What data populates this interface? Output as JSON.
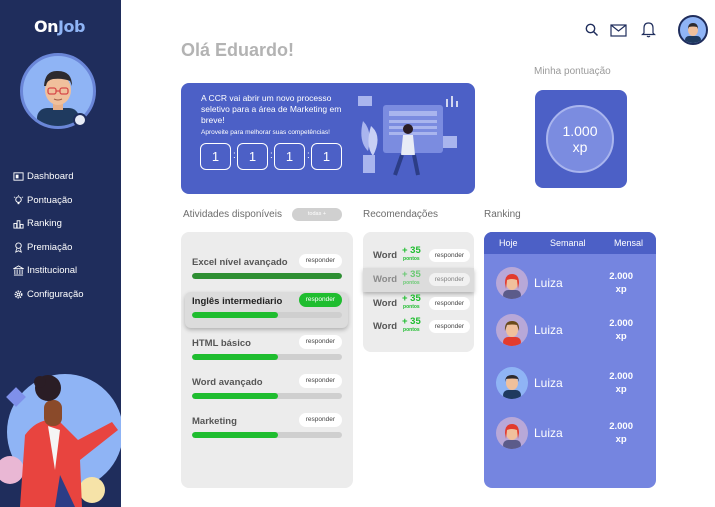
{
  "app": {
    "logo_a": "On",
    "logo_b": "Job"
  },
  "sidebar": {
    "items": [
      {
        "label": "Dashboard",
        "icon": "dashboard-icon"
      },
      {
        "label": "Pontuação",
        "icon": "lightbulb-icon"
      },
      {
        "label": "Ranking",
        "icon": "ranking-icon"
      },
      {
        "label": "Premiação",
        "icon": "award-icon"
      },
      {
        "label": "Institucional",
        "icon": "building-icon"
      },
      {
        "label": "Configuração",
        "icon": "gear-icon"
      }
    ]
  },
  "header": {
    "greeting": "Olá Eduardo!"
  },
  "banner": {
    "text": "A CCR vai abrir um novo  processo seletivo para a área de Marketing em breve!",
    "sub": "Aproveite para melhorar suas competências!",
    "countdown": [
      "1",
      "1",
      "1",
      "1"
    ],
    "colon": ":"
  },
  "score": {
    "label": "Minha pontuação",
    "value": "1.000",
    "unit": "xp"
  },
  "activities": {
    "title": "Atividades disponíveis",
    "filter": "todas +",
    "items": [
      {
        "name": "Excel nível avançado",
        "button": "responder",
        "progress": 1.0
      },
      {
        "name": "Inglês intermediario",
        "button": "responder",
        "progress": 0.57
      },
      {
        "name": "HTML básico",
        "button": "responder",
        "progress": 0.57
      },
      {
        "name": "Word avançado",
        "button": "responder",
        "progress": 0.57
      },
      {
        "name": "Marketing",
        "button": "responder",
        "progress": 0.57
      }
    ]
  },
  "recommendations": {
    "title": "Recomendações",
    "items": [
      {
        "word": "Word",
        "points": "+ 35",
        "unit": "pontos",
        "button": "responder"
      },
      {
        "word": "Word",
        "points": "+ 35",
        "unit": "pontos",
        "button": "responder"
      },
      {
        "word": "Word",
        "points": "+ 35",
        "unit": "pontos",
        "button": "responder"
      },
      {
        "word": "Word",
        "points": "+ 35",
        "unit": "pontos",
        "button": "responder"
      }
    ]
  },
  "ranking": {
    "title": "Ranking",
    "tabs": [
      "Hoje",
      "Semanal",
      "Mensal"
    ],
    "rows": [
      {
        "name": "Luiza",
        "value": "2.000",
        "unit": "xp"
      },
      {
        "name": "Luiza",
        "value": "2.000",
        "unit": "xp"
      },
      {
        "name": "Luiza",
        "value": "2.000",
        "unit": "xp"
      },
      {
        "name": "Luiza",
        "value": "2.000",
        "unit": "xp"
      }
    ]
  },
  "colors": {
    "sidebar": "#1f2d5c",
    "accent": "#4c60c6",
    "ranking_bg": "#7585e0",
    "progress": "#1fbd2f"
  }
}
